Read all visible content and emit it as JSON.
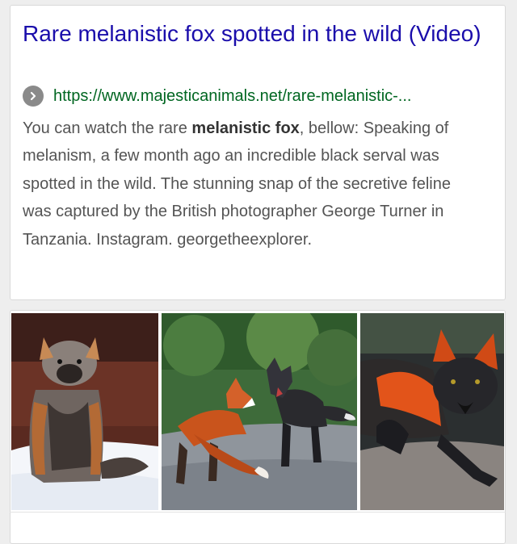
{
  "result": {
    "title": "Rare melanistic fox spotted in the wild (Video)",
    "url": "https://www.majesticanimals.net/rare-melanistic-...",
    "url_icon": "chevron-right-icon",
    "snippet": {
      "lead": "You can watch the rare ",
      "bold": "melanistic fox",
      "rest": ", bellow: Speaking of melanism, a few month ago an incredible black serval was spotted in the wild. The stunning snap of the secretive feline was captured by the British photographer George Turner in Tanzania. Instagram. georgetheexplorer."
    }
  },
  "images": [
    {
      "name": "fox-in-snow-image"
    },
    {
      "name": "red-and-black-foxes-image"
    },
    {
      "name": "melanistic-fox-closeup-image"
    }
  ],
  "colors": {
    "title": "#1a0dab",
    "url": "#006621",
    "snippet": "#545454",
    "background": "#eeeeee"
  }
}
